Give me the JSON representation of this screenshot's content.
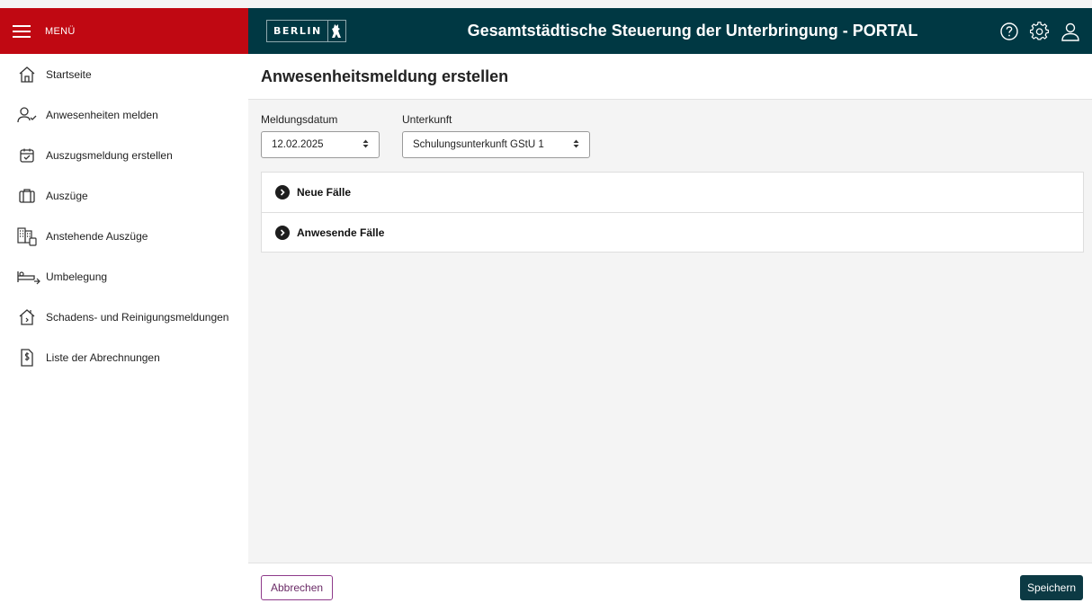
{
  "header": {
    "menu_label": "MENÜ",
    "logo_text": "BERLIN",
    "title": "Gesamtstädtische Steuerung der Unterbringung - PORTAL",
    "icons": [
      "help-icon",
      "settings-icon",
      "user-icon"
    ],
    "colors": {
      "menu_bg": "#c00812",
      "header_bg": "#003843"
    }
  },
  "sidebar": {
    "items": [
      {
        "label": "Startseite",
        "icon": "home-icon"
      },
      {
        "label": "Anwesenheiten melden",
        "icon": "user-check-icon"
      },
      {
        "label": "Auszugsmeldung erstellen",
        "icon": "calendar-check-icon"
      },
      {
        "label": "Auszüge",
        "icon": "suitcase-icon"
      },
      {
        "label": "Anstehende Auszüge",
        "icon": "buildings-icon"
      },
      {
        "label": "Umbelegung",
        "icon": "bed-icon"
      },
      {
        "label": "Schadens- und Reinigungsmeldungen",
        "icon": "house-damage-icon"
      },
      {
        "label": "Liste der Abrechnungen",
        "icon": "invoice-icon"
      }
    ]
  },
  "main": {
    "title": "Anwesenheitsmeldung erstellen",
    "filters": {
      "date_label": "Meldungsdatum",
      "date_value": "12.02.2025",
      "unterkunft_label": "Unterkunft",
      "unterkunft_value": "Schulungsunterkunft GStU 1"
    },
    "sections": [
      {
        "label": "Neue Fälle"
      },
      {
        "label": "Anwesende Fälle"
      }
    ]
  },
  "footer": {
    "cancel_label": "Abbrechen",
    "save_label": "Speichern"
  }
}
